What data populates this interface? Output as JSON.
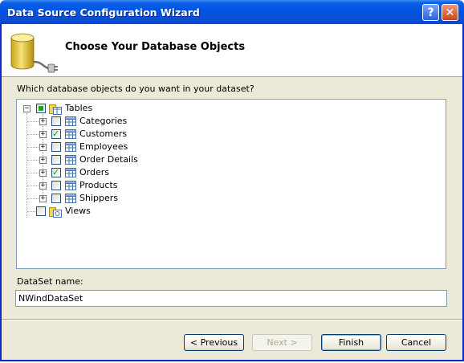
{
  "window": {
    "title": "Data Source Configuration Wizard",
    "help_glyph": "?",
    "close_glyph": "✕"
  },
  "header": {
    "title": "Choose Your Database Objects",
    "icon": "database-plug-icon"
  },
  "question": "Which database objects do you want in your dataset?",
  "tree": {
    "root": {
      "label": "Tables",
      "checked": "partial",
      "expanded": true
    },
    "tables": [
      {
        "label": "Categories",
        "checked": false
      },
      {
        "label": "Customers",
        "checked": true
      },
      {
        "label": "Employees",
        "checked": false
      },
      {
        "label": "Order Details",
        "checked": false
      },
      {
        "label": "Orders",
        "checked": true
      },
      {
        "label": "Products",
        "checked": false
      },
      {
        "label": "Shippers",
        "checked": false
      }
    ],
    "views": {
      "label": "Views",
      "checked": false
    }
  },
  "dataset": {
    "label": "DataSet name:",
    "value": "NWindDataSet"
  },
  "buttons": {
    "previous": "< Previous",
    "next": "Next >",
    "finish": "Finish",
    "cancel": "Cancel"
  },
  "colors": {
    "titlebar": "#0053e0",
    "check_green": "#21a121"
  }
}
